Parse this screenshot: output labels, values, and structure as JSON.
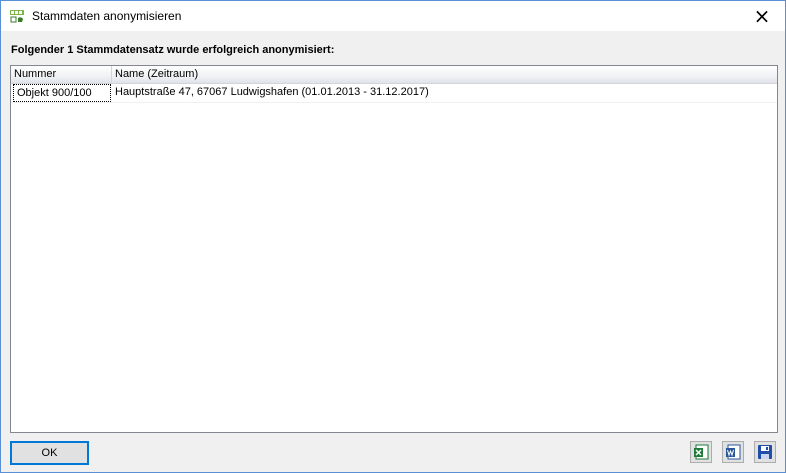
{
  "window": {
    "title": "Stammdaten anonymisieren",
    "close_symbol": "×"
  },
  "message": "Folgender 1 Stammdatensatz wurde erfolgreich anonymisiert:",
  "table": {
    "columns": [
      "Nummer",
      "Name (Zeitraum)"
    ],
    "rows": [
      [
        "Objekt 900/100",
        "Hauptstraße 47, 67067 Ludwigshafen (01.01.2013 - 31.12.2017)"
      ]
    ]
  },
  "buttons": {
    "ok_label": "OK",
    "export_icons": [
      "excel-export-icon",
      "word-export-icon",
      "save-icon"
    ]
  },
  "colors": {
    "accent": "#0078d7",
    "excel_green": "#1d7a3a",
    "word_blue": "#2b579a",
    "save_blue": "#1f4fa8"
  }
}
